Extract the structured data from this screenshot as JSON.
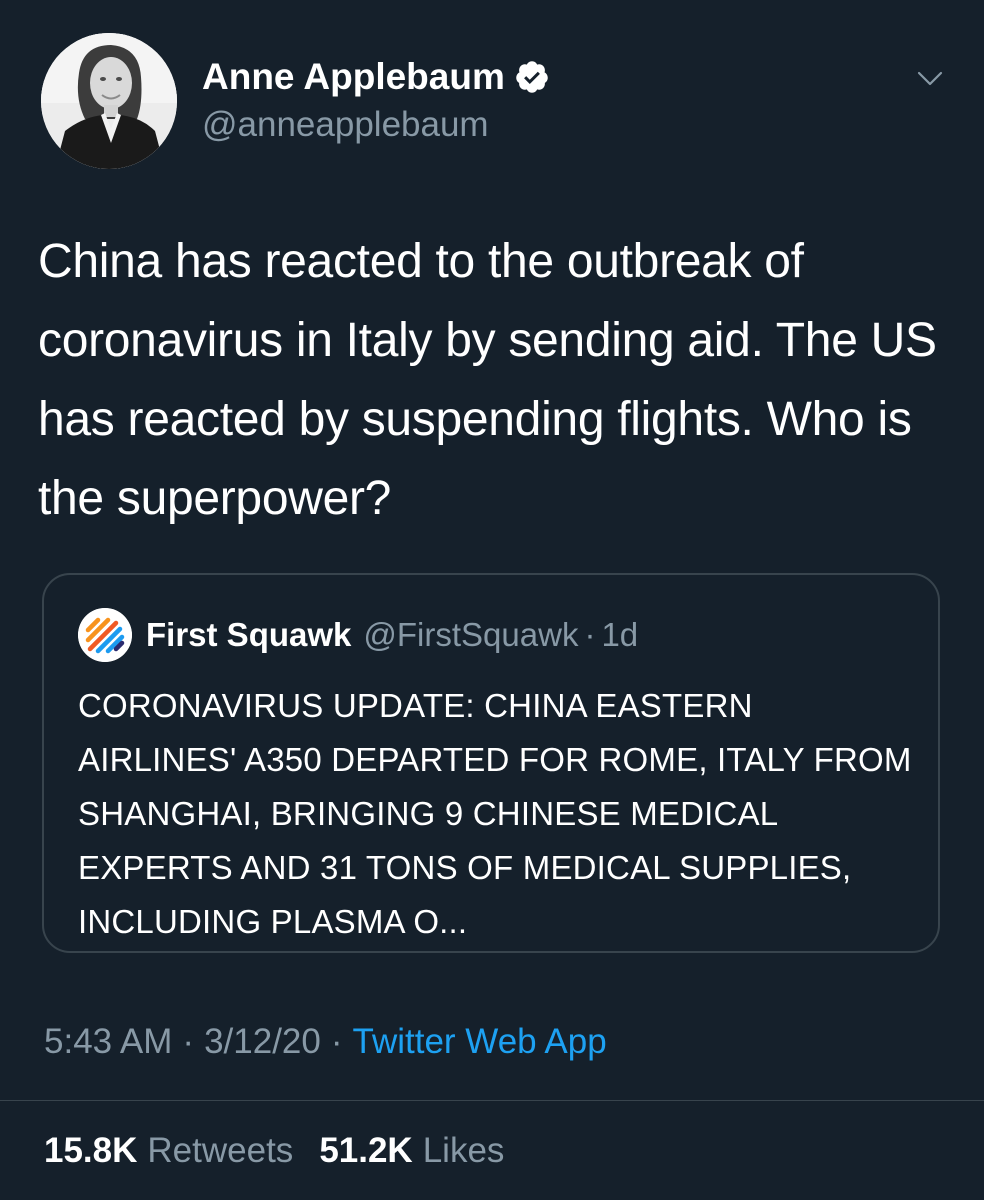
{
  "colors": {
    "background": "#15202b",
    "primary_text": "#ffffff",
    "secondary_text": "#8899a6",
    "accent": "#1da1f2",
    "border": "#38444d"
  },
  "tweet": {
    "author": {
      "display_name": "Anne Applebaum",
      "handle": "@anneapplebaum",
      "verified": true,
      "avatar_icon": "profile-photo"
    },
    "menu_icon": "chevron-down-icon",
    "text": "China has reacted to the outbreak of coronavirus in Italy by sending aid. The US has reacted by suspending flights. Who is the superpower?",
    "quoted": {
      "display_name": "First Squawk",
      "handle": "@FirstSquawk",
      "separator": "·",
      "time": "1d",
      "avatar_icon": "first-squawk-logo",
      "text": "CORONAVIRUS UPDATE: CHINA EASTERN AIRLINES' A350 DEPARTED FOR ROME, ITALY FROM SHANGHAI, BRINGING 9 CHINESE MEDICAL EXPERTS AND 31 TONS OF MEDICAL SUPPLIES, INCLUDING PLASMA O..."
    },
    "meta": {
      "time": "5:43 AM",
      "separator": "·",
      "date": "3/12/20",
      "source": "Twitter Web App"
    },
    "stats": {
      "retweets_count": "15.8K",
      "retweets_label": "Retweets",
      "likes_count": "51.2K",
      "likes_label": "Likes"
    }
  }
}
